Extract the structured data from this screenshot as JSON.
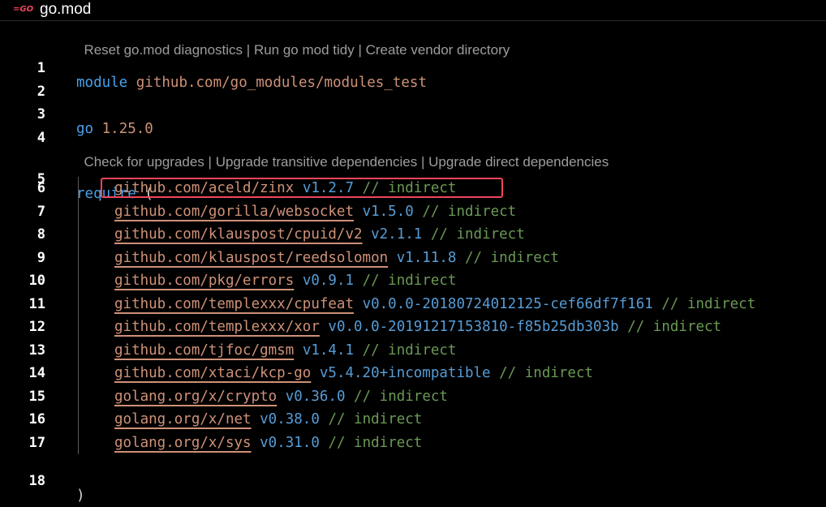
{
  "tab": {
    "icon_label": "=GO",
    "title": "go.mod"
  },
  "codelens": {
    "top": [
      "Reset go.mod diagnostics",
      "Run go mod tidy",
      "Create vendor directory"
    ],
    "require": [
      "Check for upgrades",
      "Upgrade transitive dependencies",
      "Upgrade direct dependencies"
    ],
    "separator": " | "
  },
  "lines": {
    "l1": {
      "num": "1",
      "kw": "module",
      "path": "github.com/go_modules/modules_test"
    },
    "l2": {
      "num": "2"
    },
    "l3": {
      "num": "3",
      "kw": "go",
      "version": "1.25.0"
    },
    "l4": {
      "num": "4"
    },
    "l5": {
      "num": "5",
      "kw": "require",
      "paren": "("
    },
    "l18": {
      "num": "18",
      "paren": ")"
    }
  },
  "dependencies": [
    {
      "num": "6",
      "path": "github.com/aceld/zinx",
      "version": "v1.2.7",
      "comment": "// indirect"
    },
    {
      "num": "7",
      "path": "github.com/gorilla/websocket",
      "version": "v1.5.0",
      "comment": "// indirect"
    },
    {
      "num": "8",
      "path": "github.com/klauspost/cpuid/v2",
      "version": "v2.1.1",
      "comment": "// indirect"
    },
    {
      "num": "9",
      "path": "github.com/klauspost/reedsolomon",
      "version": "v1.11.8",
      "comment": "// indirect"
    },
    {
      "num": "10",
      "path": "github.com/pkg/errors",
      "version": "v0.9.1",
      "comment": "// indirect"
    },
    {
      "num": "11",
      "path": "github.com/templexxx/cpufeat",
      "version": "v0.0.0-20180724012125-cef66df7f161",
      "comment": "// indirect"
    },
    {
      "num": "12",
      "path": "github.com/templexxx/xor",
      "version": "v0.0.0-20191217153810-f85b25db303b",
      "comment": "// indirect"
    },
    {
      "num": "13",
      "path": "github.com/tjfoc/gmsm",
      "version": "v1.4.1",
      "comment": "// indirect"
    },
    {
      "num": "14",
      "path": "github.com/xtaci/kcp-go",
      "version": "v5.4.20+incompatible",
      "comment": "// indirect"
    },
    {
      "num": "15",
      "path": "golang.org/x/crypto",
      "version": "v0.36.0",
      "comment": "// indirect"
    },
    {
      "num": "16",
      "path": "golang.org/x/net",
      "version": "v0.38.0",
      "comment": "// indirect"
    },
    {
      "num": "17",
      "path": "golang.org/x/sys",
      "version": "v0.31.0",
      "comment": "// indirect"
    }
  ],
  "colors": {
    "keyword": "#4aa0ea",
    "string": "#ce9178",
    "version": "#569cd6",
    "comment": "#6a9955",
    "highlight_border": "#f0465a",
    "codelens": "#9d9d9d"
  }
}
